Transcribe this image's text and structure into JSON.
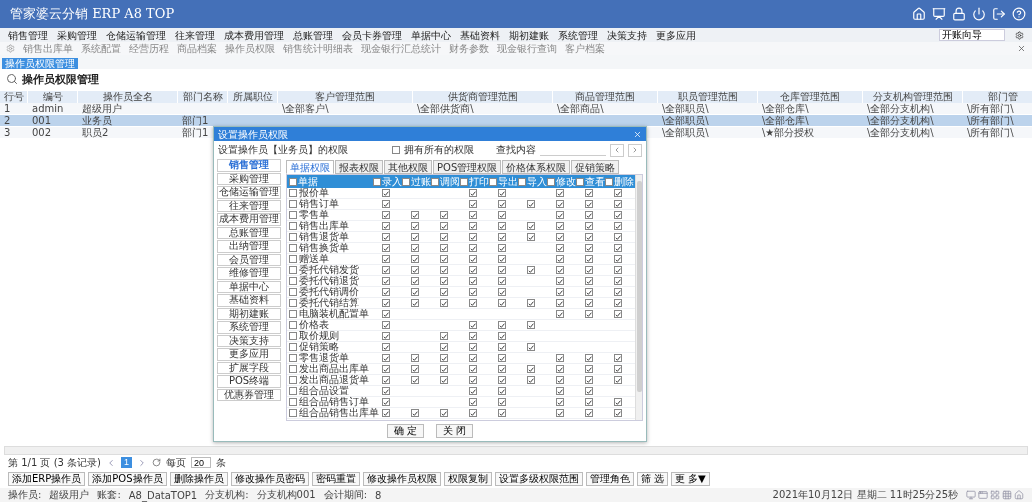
{
  "app": {
    "title": "管家婆云分销 ERP A8 TOP"
  },
  "menu": [
    "销售管理",
    "采购管理",
    "仓储运输管理",
    "往来管理",
    "成本费用管理",
    "总账管理",
    "会员卡券管理",
    "单据中心",
    "基础资料",
    "期初建账",
    "系统管理",
    "决策支持",
    "更多应用"
  ],
  "quick_search": {
    "value": "开账向导"
  },
  "quick_links": [
    "销售出库单",
    "系统配置",
    "经营历程",
    "商品档案",
    "操作员权限",
    "销售统计明细表",
    "现金银行汇总统计",
    "财务参数",
    "现金银行查询",
    "客户档案"
  ],
  "open_tabs": [
    {
      "label": "操作员权限管理",
      "selected": true
    }
  ],
  "page_title": "操作员权限管理",
  "table": {
    "columns": [
      "行号",
      "编号",
      "操作员全名",
      "部门名称",
      "所属职位",
      "客户管理范围",
      "供货商管理范围",
      "商品管理范围",
      "职员管理范围",
      "仓库管理范围",
      "分支机构管理范围",
      "部门管"
    ],
    "rows": [
      {
        "selected": false,
        "cells": [
          "1",
          "admin",
          "超级用户"
        ],
        "right_cells": [
          "\\全部客户\\",
          "\\全部供货商\\",
          "\\全部商品\\",
          "\\全部职员\\",
          "\\全部仓库\\",
          "\\全部分支机构\\",
          "\\所有部门\\"
        ]
      },
      {
        "selected": true,
        "cells": [
          "2",
          "001",
          "业务员",
          "部门1"
        ],
        "right_cells": [
          "\\全部职员\\",
          "\\全部仓库\\",
          "\\全部分支机构\\",
          "\\所有部门\\"
        ]
      },
      {
        "selected": false,
        "cells": [
          "3",
          "002",
          "职员2",
          "部门1"
        ],
        "right_cells": [
          "\\全部职员\\",
          "\\★部分授权",
          "\\全部分支机构\\",
          "\\所有部门\\"
        ]
      }
    ]
  },
  "dialog": {
    "title": "设置操作员权限",
    "subject": "设置操作员【业务员】的权限",
    "all_permissions": {
      "label": "拥有所有的权限",
      "checked": false
    },
    "search": {
      "label": "查找内容"
    },
    "modules": [
      {
        "label": "销售管理",
        "selected": true
      },
      {
        "label": "采购管理",
        "selected": false
      },
      {
        "label": "仓储运输管理",
        "selected": false
      },
      {
        "label": "往来管理",
        "selected": false
      },
      {
        "label": "成本费用管理",
        "selected": false
      },
      {
        "label": "总账管理",
        "selected": false
      },
      {
        "label": "出纳管理",
        "selected": false
      },
      {
        "label": "会员管理",
        "selected": false
      },
      {
        "label": "维修管理",
        "selected": false
      },
      {
        "label": "单据中心",
        "selected": false
      },
      {
        "label": "基础资料",
        "selected": false
      },
      {
        "label": "期初建账",
        "selected": false
      },
      {
        "label": "系统管理",
        "selected": false
      },
      {
        "label": "决策支持",
        "selected": false
      },
      {
        "label": "更多应用",
        "selected": false
      },
      {
        "label": "扩展字段",
        "selected": false
      },
      {
        "label": "POS终端",
        "selected": false
      },
      {
        "label": "优惠券管理",
        "selected": false
      }
    ],
    "tabs": [
      {
        "label": "单据权限",
        "selected": true
      },
      {
        "label": "报表权限",
        "selected": false
      },
      {
        "label": "其他权限",
        "selected": false
      },
      {
        "label": "POS管理权限",
        "selected": false
      },
      {
        "label": "价格体系权限",
        "selected": false
      },
      {
        "label": "促销策略",
        "selected": false
      }
    ],
    "grid": {
      "first_column": {
        "label": "单据",
        "checked": false
      },
      "columns": [
        {
          "label": "录入",
          "checked": false
        },
        {
          "label": "过账",
          "checked": false
        },
        {
          "label": "调阅",
          "checked": false
        },
        {
          "label": "打印",
          "checked": false
        },
        {
          "label": "导出",
          "checked": false
        },
        {
          "label": "导入",
          "checked": false
        },
        {
          "label": "修改",
          "checked": false
        },
        {
          "label": "查看",
          "checked": false
        },
        {
          "label": "删除",
          "checked": false
        }
      ],
      "rows": [
        {
          "label": "报价单",
          "checked": false,
          "checks": [
            true,
            false,
            false,
            true,
            true,
            false,
            true,
            true,
            true
          ]
        },
        {
          "label": "销售订单",
          "checked": false,
          "checks": [
            true,
            false,
            false,
            true,
            true,
            true,
            true,
            true,
            true
          ]
        },
        {
          "label": "零售单",
          "checked": false,
          "checks": [
            true,
            true,
            true,
            true,
            true,
            false,
            true,
            true,
            true
          ]
        },
        {
          "label": "销售出库单",
          "checked": false,
          "checks": [
            true,
            true,
            true,
            true,
            true,
            true,
            true,
            true,
            true
          ]
        },
        {
          "label": "销售退货单",
          "checked": false,
          "checks": [
            true,
            true,
            true,
            true,
            true,
            true,
            true,
            true,
            true
          ]
        },
        {
          "label": "销售换货单",
          "checked": false,
          "checks": [
            true,
            true,
            true,
            true,
            true,
            false,
            true,
            true,
            true
          ]
        },
        {
          "label": "赠送单",
          "checked": false,
          "checks": [
            true,
            true,
            true,
            true,
            true,
            false,
            true,
            true,
            true
          ]
        },
        {
          "label": "委托代销发货",
          "checked": false,
          "checks": [
            true,
            true,
            true,
            true,
            true,
            true,
            true,
            true,
            true
          ]
        },
        {
          "label": "委托代销退货",
          "checked": false,
          "checks": [
            true,
            true,
            true,
            true,
            true,
            false,
            true,
            true,
            true
          ]
        },
        {
          "label": "委托代销调价",
          "checked": false,
          "checks": [
            true,
            true,
            true,
            true,
            true,
            false,
            true,
            true,
            true
          ]
        },
        {
          "label": "委托代销结算",
          "checked": false,
          "checks": [
            true,
            true,
            true,
            true,
            true,
            true,
            true,
            true,
            true
          ]
        },
        {
          "label": "电脑装机配置单",
          "checked": false,
          "checks": [
            true,
            false,
            false,
            false,
            false,
            false,
            true,
            true,
            true
          ]
        },
        {
          "label": "价格表",
          "checked": false,
          "checks": [
            true,
            false,
            false,
            true,
            true,
            true,
            false,
            false,
            false
          ]
        },
        {
          "label": "取价规则",
          "checked": false,
          "checks": [
            true,
            false,
            true,
            true,
            true,
            false,
            false,
            false,
            false
          ]
        },
        {
          "label": "促销策略",
          "checked": false,
          "checks": [
            true,
            false,
            true,
            true,
            true,
            true,
            false,
            false,
            false
          ]
        },
        {
          "label": "零售退货单",
          "checked": false,
          "checks": [
            true,
            true,
            true,
            true,
            true,
            false,
            true,
            true,
            true
          ]
        },
        {
          "label": "发出商品出库单",
          "checked": false,
          "checks": [
            true,
            true,
            true,
            true,
            true,
            true,
            true,
            true,
            true
          ]
        },
        {
          "label": "发出商品退货单",
          "checked": false,
          "checks": [
            true,
            true,
            true,
            true,
            true,
            true,
            true,
            true,
            true
          ]
        },
        {
          "label": "组合品设置",
          "checked": false,
          "checks": [
            true,
            false,
            false,
            true,
            true,
            false,
            true,
            true,
            false
          ]
        },
        {
          "label": "组合品销售订单",
          "checked": false,
          "checks": [
            true,
            false,
            false,
            true,
            true,
            false,
            true,
            true,
            true
          ]
        },
        {
          "label": "组合品销售出库单",
          "checked": false,
          "checks": [
            true,
            true,
            true,
            true,
            true,
            false,
            true,
            true,
            true
          ]
        }
      ]
    },
    "buttons": [
      "确 定",
      "关 闭"
    ]
  },
  "pager": {
    "summary": "第 1/1 页 (3 条记录)",
    "page": "1",
    "per_page_label": "每页",
    "per_page": "20",
    "unit": "条"
  },
  "actions": [
    "添加ERP操作员",
    "添加POS操作员",
    "删除操作员",
    "修改操作员密码",
    "密码重置",
    "修改操作员权限",
    "权限复制",
    "设置多级权限范围",
    "管理角色",
    "筛 选",
    "更 多▼"
  ],
  "status_bar": {
    "items": [
      {
        "label": "操作员:",
        "value": "超级用户"
      },
      {
        "label": "账套:",
        "value": "A8_DataTOP1"
      },
      {
        "label": "分支机构:",
        "value": "分支机构001"
      },
      {
        "label": "会计期间:",
        "value": "8"
      }
    ],
    "datetime": "2021年10月12日 星期二 11时25分25秒"
  }
}
